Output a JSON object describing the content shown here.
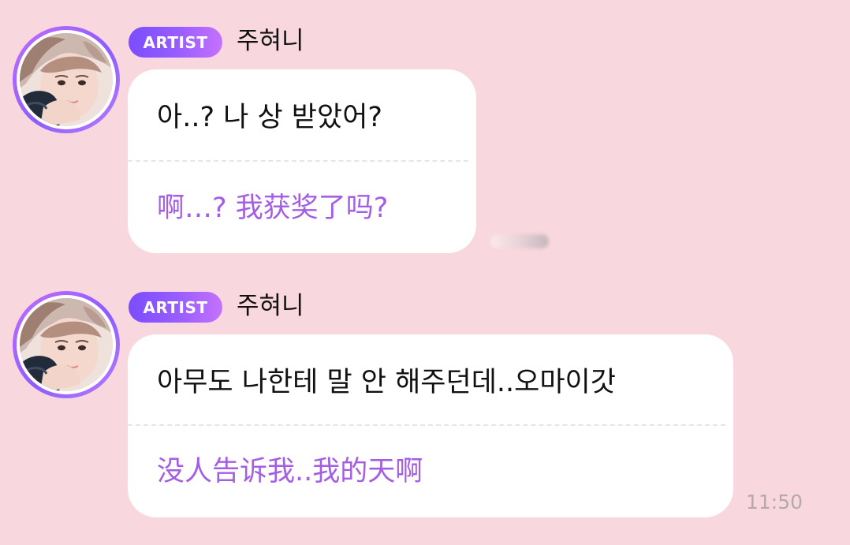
{
  "colors": {
    "background": "#f9d7de",
    "bubble": "#ffffff",
    "translation_text": "#a35ee3",
    "badge_gradient_start": "#7a4dff",
    "badge_gradient_end": "#c472ff",
    "time_text": "#b4a9ad"
  },
  "messages": [
    {
      "badge": "ARTIST",
      "sender": "주혀니",
      "avatar_icon": "artist-avatar-photo",
      "korean": "아..? 나 상 받았어?",
      "chinese": "啊…? 我获奖了吗?"
    },
    {
      "badge": "ARTIST",
      "sender": "주혀니",
      "avatar_icon": "artist-avatar-photo",
      "korean": "아무도 나한테 말 안 해주던데..오마이갓",
      "chinese": "没人告诉我..我的天啊",
      "time": "11:50"
    }
  ]
}
